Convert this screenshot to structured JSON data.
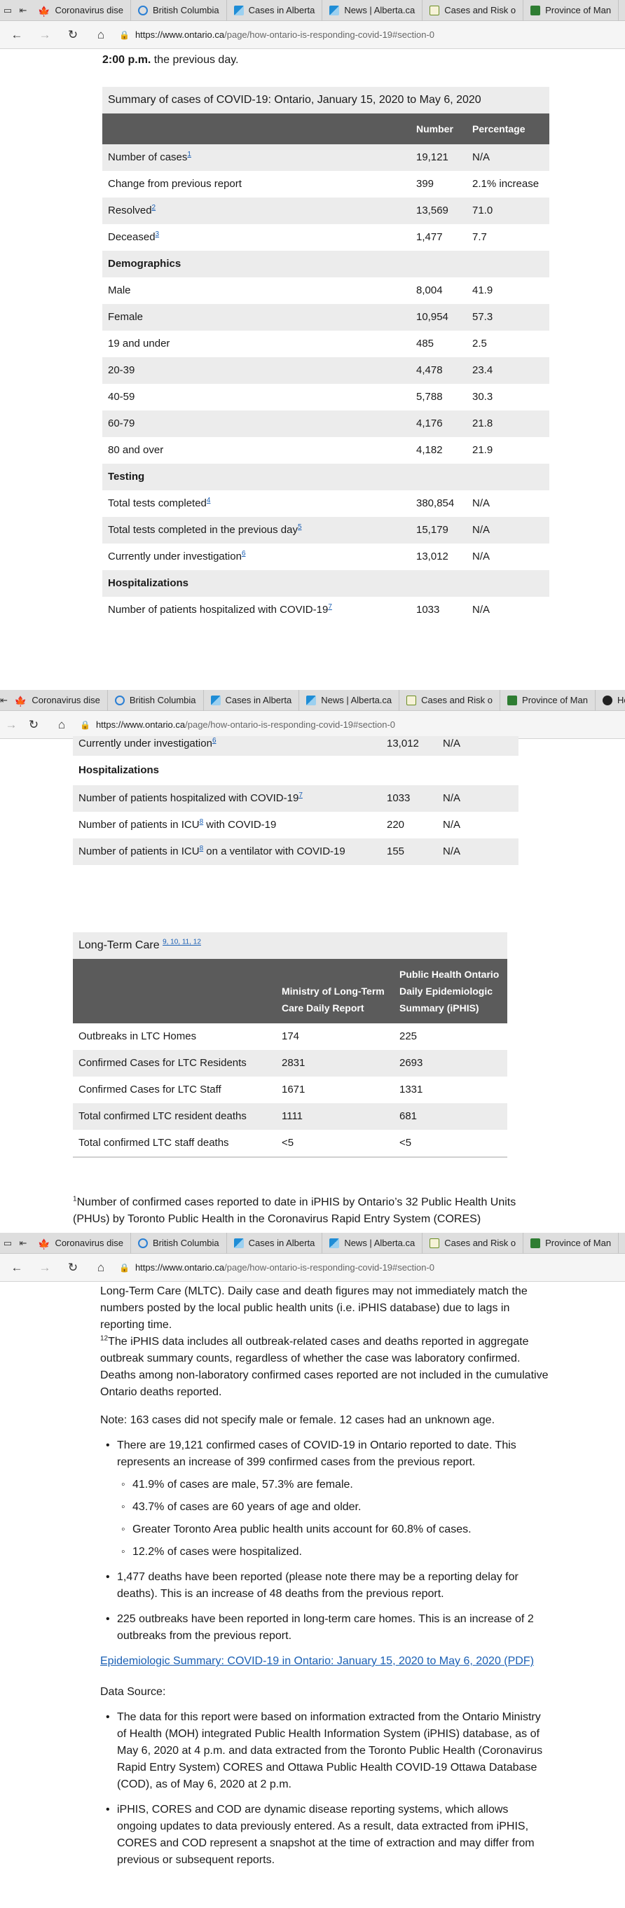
{
  "browser": {
    "tabs": [
      {
        "label": "Coronavirus dise",
        "icon": "maple-leaf-icon",
        "color": "#d52b1e"
      },
      {
        "label": "British Columbia",
        "icon": "globe-icon",
        "color": "#2a7fd4"
      },
      {
        "label": "Cases in Alberta",
        "icon": "chart-icon",
        "color": "#1f8dd6"
      },
      {
        "label": "News | Alberta.ca",
        "icon": "chart-icon",
        "color": "#1f8dd6"
      },
      {
        "label": "Cases and Risk o",
        "icon": "document-icon",
        "color": "#6b8e23"
      },
      {
        "label": "Province of Man",
        "icon": "flag-icon",
        "color": "#2e7d32"
      }
    ],
    "extra_tab": "Ho",
    "url_host": "https://www.ontario.ca",
    "url_path": "/page/how-ontario-is-responding-covid-19#section-0"
  },
  "section1": {
    "intro_partial": "2:00 p.m.",
    "intro_rest": " the previous day.",
    "table_caption": "Summary of cases of COVID-19: Ontario, January 15, 2020 to May 6, 2020",
    "headers": [
      "",
      "Number",
      "Percentage"
    ],
    "rows": [
      {
        "label": "Number of cases",
        "sup": "1",
        "num": "19,121",
        "pct": "N/A"
      },
      {
        "label": "Change from previous report",
        "sup": "",
        "num": "399",
        "pct": "2.1% increase"
      },
      {
        "label": "Resolved",
        "sup": "2",
        "num": "13,569",
        "pct": "71.0"
      },
      {
        "label": "Deceased",
        "sup": "3",
        "num": "1,477",
        "pct": "7.7"
      }
    ],
    "demographics_title": "Demographics",
    "demographics": [
      {
        "label": "Male",
        "num": "8,004",
        "pct": "41.9"
      },
      {
        "label": "Female",
        "num": "10,954",
        "pct": "57.3"
      },
      {
        "label": "19 and under",
        "num": "485",
        "pct": "2.5"
      },
      {
        "label": "20-39",
        "num": "4,478",
        "pct": "23.4"
      },
      {
        "label": "40-59",
        "num": "5,788",
        "pct": "30.3"
      },
      {
        "label": "60-79",
        "num": "4,176",
        "pct": "21.8"
      },
      {
        "label": "80 and over",
        "num": "4,182",
        "pct": "21.9"
      }
    ],
    "testing_title": "Testing",
    "testing": [
      {
        "label": "Total tests completed",
        "sup": "4",
        "num": "380,854",
        "pct": "N/A"
      },
      {
        "label": "Total tests completed in the previous day",
        "sup": "5",
        "num": "15,179",
        "pct": "N/A"
      },
      {
        "label": "Currently under investigation",
        "sup": "6",
        "num": "13,012",
        "pct": "N/A"
      }
    ],
    "hosp_title": "Hospitalizations",
    "hosp_partial": {
      "label": "Number of patients hospitalized with COVID-19",
      "sup": "7",
      "num": "1033",
      "pct": "N/A"
    }
  },
  "section2": {
    "partial_row": {
      "label": "Currently under investigation",
      "sup": "6",
      "num": "13,012",
      "pct": "N/A"
    },
    "hosp_title": "Hospitalizations",
    "hosp_rows": [
      {
        "label": "Number of patients hospitalized with COVID-19",
        "sup": "7",
        "mid": "",
        "num": "1033",
        "pct": "N/A"
      },
      {
        "label": "Number of patients in ICU",
        "sup": "8",
        "mid": " with COVID-19",
        "num": "220",
        "pct": "N/A"
      },
      {
        "label": "Number of patients in ICU",
        "sup": "8",
        "mid": " on a ventilator with COVID-19",
        "num": "155",
        "pct": "N/A"
      }
    ],
    "ltc_caption": "Long-Term Care",
    "ltc_sups": "9, 10, 11, 12",
    "ltc_headers": [
      "",
      "Ministry of Long-Term Care Daily Report",
      "Public Health Ontario Daily Epidemiologic Summary (iPHIS)"
    ],
    "ltc_rows": [
      {
        "label": "Outbreaks in LTC Homes",
        "a": "174",
        "b": "225"
      },
      {
        "label": "Confirmed Cases for LTC Residents",
        "a": "2831",
        "b": "2693"
      },
      {
        "label": "Confirmed Cases for LTC Staff",
        "a": "1671",
        "b": "1331"
      },
      {
        "label": "Total confirmed LTC resident deaths",
        "a": "1111",
        "b": "681"
      },
      {
        "label": "Total confirmed LTC staff deaths",
        "a": "<5",
        "b": "<5"
      }
    ],
    "footnote_sup": "1",
    "footnote_text": "Number of confirmed cases reported to date in iPHIS by Ontario’s 32 Public Health Units (PHUs) by Toronto Public Health in the Coronavirus Rapid Entry System (CORES)"
  },
  "section3": {
    "partial_text": "Long-Term Care (MLTC). Daily case and death figures may not immediately match the numbers posted by the local public health units (i.e. iPHIS database) due to lags in reporting time.",
    "fn12_sup": "12",
    "fn12_text": "The iPHIS data includes all outbreak-related cases and deaths reported in aggregate outbreak summary counts, regardless of whether the case was laboratory confirmed. Deaths among non-laboratory confirmed cases reported are not included in the cumulative Ontario deaths reported.",
    "note": "Note: 163 cases did not specify male or female. 12 cases had an unknown age.",
    "bullet1": "There are 19,121 confirmed cases of COVID-19 in Ontario reported to date. This represents an increase of 399 confirmed cases from the previous report.",
    "sub_bullets": [
      "41.9% of cases are male, 57.3% are female.",
      "43.7% of cases are 60 years of age and older.",
      "Greater Toronto Area public health units account for 60.8% of cases.",
      "12.2% of cases were hospitalized."
    ],
    "bullet2": "1,477 deaths have been reported (please note there may be a reporting delay for deaths). This is an increase of 48 deaths from the previous report.",
    "bullet3": "225 outbreaks have been reported in long-term care homes. This is an increase of 2 outbreaks from the previous report.",
    "link": "Epidemiologic Summary: COVID-19 in Ontario: January 15, 2020 to May 6, 2020 (PDF)",
    "data_source": "Data Source:",
    "ds_bullets": [
      "The data for this report were based on information extracted from the Ontario Ministry of Health (MOH) integrated Public Health Information System (iPHIS) database, as of May 6, 2020 at 4 p.m. and data extracted from the Toronto Public Health (Coronavirus Rapid Entry System) CORES and Ottawa Public Health COVID-19 Ottawa Database (COD), as of May 6, 2020 at 2 p.m.",
      "iPHIS, CORES and COD are dynamic disease reporting systems, which allows ongoing updates to data previously entered. As a result, data extracted from iPHIS, CORES and COD represent a snapshot at the time of extraction and may differ from previous or subsequent reports."
    ]
  }
}
